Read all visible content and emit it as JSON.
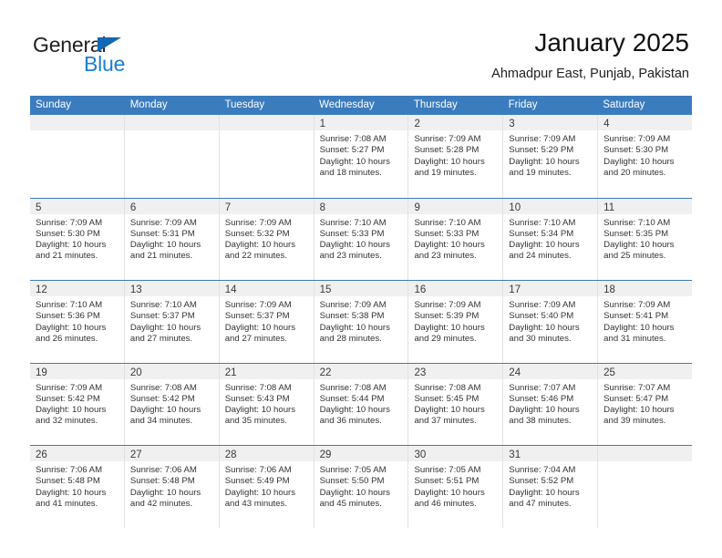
{
  "brand": {
    "name_part1": "General",
    "name_part2": "Blue",
    "color_blue": "#1b7fd4",
    "color_triangle": "#1268b3"
  },
  "header": {
    "title": "January 2025",
    "subtitle": "Ahmadpur East, Punjab, Pakistan",
    "accent_color": "#3b7cbf"
  },
  "weekdays": [
    "Sunday",
    "Monday",
    "Tuesday",
    "Wednesday",
    "Thursday",
    "Friday",
    "Saturday"
  ],
  "weeks": [
    [
      {
        "day": "",
        "sunrise": "",
        "sunset": "",
        "daylight1": "",
        "daylight2": ""
      },
      {
        "day": "",
        "sunrise": "",
        "sunset": "",
        "daylight1": "",
        "daylight2": ""
      },
      {
        "day": "",
        "sunrise": "",
        "sunset": "",
        "daylight1": "",
        "daylight2": ""
      },
      {
        "day": "1",
        "sunrise": "Sunrise: 7:08 AM",
        "sunset": "Sunset: 5:27 PM",
        "daylight1": "Daylight: 10 hours",
        "daylight2": "and 18 minutes."
      },
      {
        "day": "2",
        "sunrise": "Sunrise: 7:09 AM",
        "sunset": "Sunset: 5:28 PM",
        "daylight1": "Daylight: 10 hours",
        "daylight2": "and 19 minutes."
      },
      {
        "day": "3",
        "sunrise": "Sunrise: 7:09 AM",
        "sunset": "Sunset: 5:29 PM",
        "daylight1": "Daylight: 10 hours",
        "daylight2": "and 19 minutes."
      },
      {
        "day": "4",
        "sunrise": "Sunrise: 7:09 AM",
        "sunset": "Sunset: 5:30 PM",
        "daylight1": "Daylight: 10 hours",
        "daylight2": "and 20 minutes."
      }
    ],
    [
      {
        "day": "5",
        "sunrise": "Sunrise: 7:09 AM",
        "sunset": "Sunset: 5:30 PM",
        "daylight1": "Daylight: 10 hours",
        "daylight2": "and 21 minutes."
      },
      {
        "day": "6",
        "sunrise": "Sunrise: 7:09 AM",
        "sunset": "Sunset: 5:31 PM",
        "daylight1": "Daylight: 10 hours",
        "daylight2": "and 21 minutes."
      },
      {
        "day": "7",
        "sunrise": "Sunrise: 7:09 AM",
        "sunset": "Sunset: 5:32 PM",
        "daylight1": "Daylight: 10 hours",
        "daylight2": "and 22 minutes."
      },
      {
        "day": "8",
        "sunrise": "Sunrise: 7:10 AM",
        "sunset": "Sunset: 5:33 PM",
        "daylight1": "Daylight: 10 hours",
        "daylight2": "and 23 minutes."
      },
      {
        "day": "9",
        "sunrise": "Sunrise: 7:10 AM",
        "sunset": "Sunset: 5:33 PM",
        "daylight1": "Daylight: 10 hours",
        "daylight2": "and 23 minutes."
      },
      {
        "day": "10",
        "sunrise": "Sunrise: 7:10 AM",
        "sunset": "Sunset: 5:34 PM",
        "daylight1": "Daylight: 10 hours",
        "daylight2": "and 24 minutes."
      },
      {
        "day": "11",
        "sunrise": "Sunrise: 7:10 AM",
        "sunset": "Sunset: 5:35 PM",
        "daylight1": "Daylight: 10 hours",
        "daylight2": "and 25 minutes."
      }
    ],
    [
      {
        "day": "12",
        "sunrise": "Sunrise: 7:10 AM",
        "sunset": "Sunset: 5:36 PM",
        "daylight1": "Daylight: 10 hours",
        "daylight2": "and 26 minutes."
      },
      {
        "day": "13",
        "sunrise": "Sunrise: 7:10 AM",
        "sunset": "Sunset: 5:37 PM",
        "daylight1": "Daylight: 10 hours",
        "daylight2": "and 27 minutes."
      },
      {
        "day": "14",
        "sunrise": "Sunrise: 7:09 AM",
        "sunset": "Sunset: 5:37 PM",
        "daylight1": "Daylight: 10 hours",
        "daylight2": "and 27 minutes."
      },
      {
        "day": "15",
        "sunrise": "Sunrise: 7:09 AM",
        "sunset": "Sunset: 5:38 PM",
        "daylight1": "Daylight: 10 hours",
        "daylight2": "and 28 minutes."
      },
      {
        "day": "16",
        "sunrise": "Sunrise: 7:09 AM",
        "sunset": "Sunset: 5:39 PM",
        "daylight1": "Daylight: 10 hours",
        "daylight2": "and 29 minutes."
      },
      {
        "day": "17",
        "sunrise": "Sunrise: 7:09 AM",
        "sunset": "Sunset: 5:40 PM",
        "daylight1": "Daylight: 10 hours",
        "daylight2": "and 30 minutes."
      },
      {
        "day": "18",
        "sunrise": "Sunrise: 7:09 AM",
        "sunset": "Sunset: 5:41 PM",
        "daylight1": "Daylight: 10 hours",
        "daylight2": "and 31 minutes."
      }
    ],
    [
      {
        "day": "19",
        "sunrise": "Sunrise: 7:09 AM",
        "sunset": "Sunset: 5:42 PM",
        "daylight1": "Daylight: 10 hours",
        "daylight2": "and 32 minutes."
      },
      {
        "day": "20",
        "sunrise": "Sunrise: 7:08 AM",
        "sunset": "Sunset: 5:42 PM",
        "daylight1": "Daylight: 10 hours",
        "daylight2": "and 34 minutes."
      },
      {
        "day": "21",
        "sunrise": "Sunrise: 7:08 AM",
        "sunset": "Sunset: 5:43 PM",
        "daylight1": "Daylight: 10 hours",
        "daylight2": "and 35 minutes."
      },
      {
        "day": "22",
        "sunrise": "Sunrise: 7:08 AM",
        "sunset": "Sunset: 5:44 PM",
        "daylight1": "Daylight: 10 hours",
        "daylight2": "and 36 minutes."
      },
      {
        "day": "23",
        "sunrise": "Sunrise: 7:08 AM",
        "sunset": "Sunset: 5:45 PM",
        "daylight1": "Daylight: 10 hours",
        "daylight2": "and 37 minutes."
      },
      {
        "day": "24",
        "sunrise": "Sunrise: 7:07 AM",
        "sunset": "Sunset: 5:46 PM",
        "daylight1": "Daylight: 10 hours",
        "daylight2": "and 38 minutes."
      },
      {
        "day": "25",
        "sunrise": "Sunrise: 7:07 AM",
        "sunset": "Sunset: 5:47 PM",
        "daylight1": "Daylight: 10 hours",
        "daylight2": "and 39 minutes."
      }
    ],
    [
      {
        "day": "26",
        "sunrise": "Sunrise: 7:06 AM",
        "sunset": "Sunset: 5:48 PM",
        "daylight1": "Daylight: 10 hours",
        "daylight2": "and 41 minutes."
      },
      {
        "day": "27",
        "sunrise": "Sunrise: 7:06 AM",
        "sunset": "Sunset: 5:48 PM",
        "daylight1": "Daylight: 10 hours",
        "daylight2": "and 42 minutes."
      },
      {
        "day": "28",
        "sunrise": "Sunrise: 7:06 AM",
        "sunset": "Sunset: 5:49 PM",
        "daylight1": "Daylight: 10 hours",
        "daylight2": "and 43 minutes."
      },
      {
        "day": "29",
        "sunrise": "Sunrise: 7:05 AM",
        "sunset": "Sunset: 5:50 PM",
        "daylight1": "Daylight: 10 hours",
        "daylight2": "and 45 minutes."
      },
      {
        "day": "30",
        "sunrise": "Sunrise: 7:05 AM",
        "sunset": "Sunset: 5:51 PM",
        "daylight1": "Daylight: 10 hours",
        "daylight2": "and 46 minutes."
      },
      {
        "day": "31",
        "sunrise": "Sunrise: 7:04 AM",
        "sunset": "Sunset: 5:52 PM",
        "daylight1": "Daylight: 10 hours",
        "daylight2": "and 47 minutes."
      },
      {
        "day": "",
        "sunrise": "",
        "sunset": "",
        "daylight1": "",
        "daylight2": ""
      }
    ]
  ]
}
